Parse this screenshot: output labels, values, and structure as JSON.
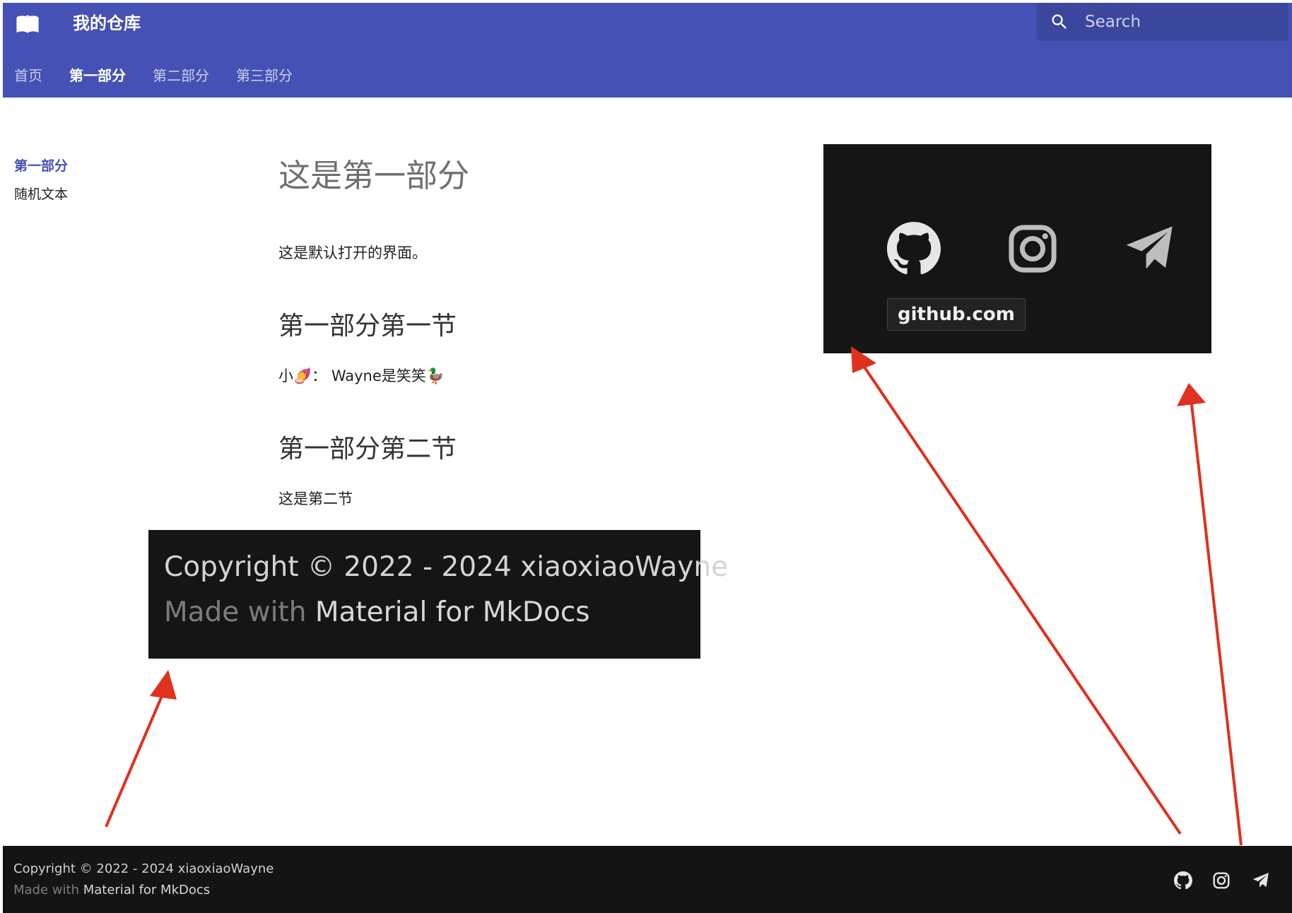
{
  "header": {
    "logo_icon": "book-open-user-icon",
    "site_title": "我的仓库",
    "search_placeholder": "Search",
    "background": "#4551b5",
    "tabs": [
      {
        "label": "首页",
        "active": false
      },
      {
        "label": "第一部分",
        "active": true
      },
      {
        "label": "第二部分",
        "active": false
      },
      {
        "label": "第三部分",
        "active": false
      }
    ]
  },
  "sidebar": {
    "title": "第一部分",
    "items": [
      {
        "label": "随机文本"
      }
    ]
  },
  "content": {
    "h1": "这是第一部分",
    "intro": "这是默认打开的界面。",
    "section1_title": "第一部分第一节",
    "section1_text": "小🍠： Wayne是笑笑🦆",
    "section2_title": "第一部分第二节",
    "section2_text": "这是第二节"
  },
  "callouts": {
    "copyright_zoom": {
      "line1": "Copyright © 2022 - 2024 xiaoxiaoWayne",
      "made_with": "Made with",
      "material_link": "Material for MkDocs"
    },
    "social_zoom": {
      "icons": [
        "github-icon",
        "instagram-icon",
        "telegram-icon"
      ],
      "tooltip": "github.com"
    },
    "arrow_color": "#e0301e"
  },
  "footer": {
    "copyright": "Copyright © 2022 - 2024 xiaoxiaoWayne",
    "made_with": "Made with",
    "material_link": "Material for MkDocs",
    "social_icons": [
      "github-icon",
      "instagram-icon",
      "telegram-icon"
    ]
  }
}
